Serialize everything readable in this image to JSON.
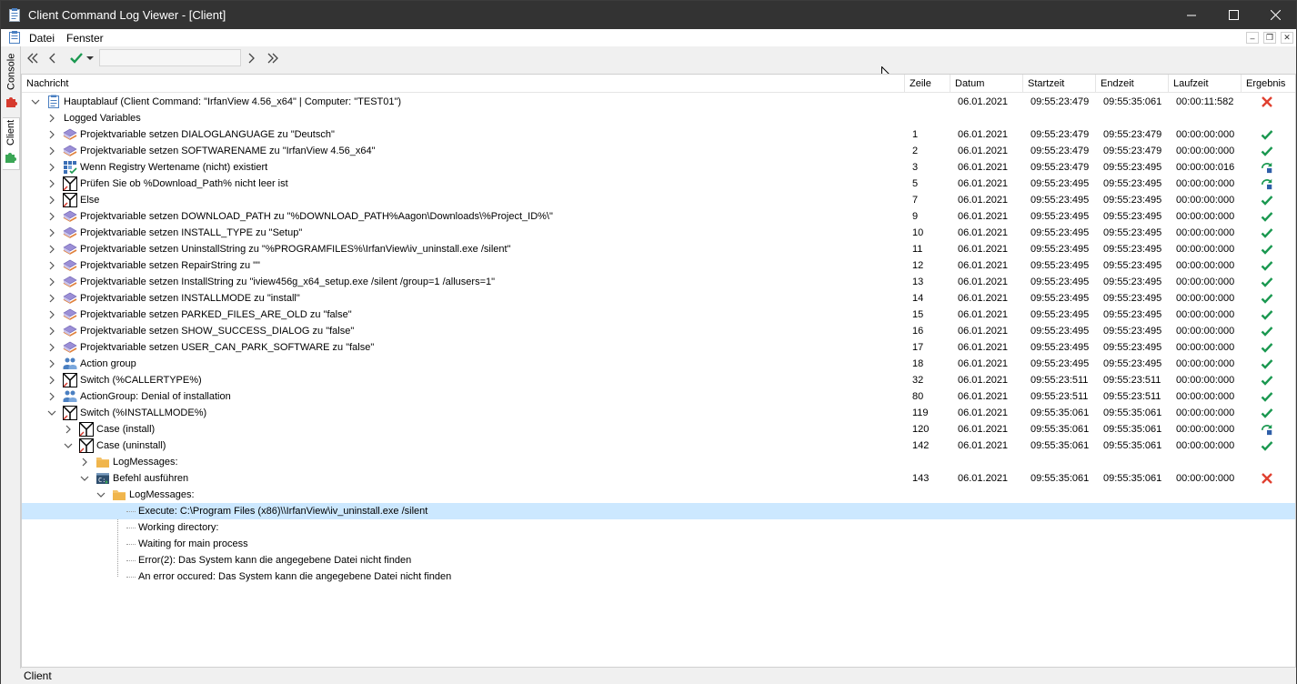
{
  "window": {
    "title": "Client Command Log Viewer - [Client]",
    "status": "Client",
    "colors": {
      "titlebar": "#333333",
      "selection": "#cce8ff",
      "ok": "#1a9850",
      "error": "#e04030"
    }
  },
  "menu": {
    "datei": "Datei",
    "fenster": "Fenster"
  },
  "side_tabs": {
    "console": "Console",
    "client": "Client"
  },
  "toolbar": {
    "first_icon": "double-chevron-left-icon",
    "prev_icon": "chevron-left-icon",
    "filter_icon": "check-filter-icon",
    "search_value": "",
    "next_icon": "chevron-right-icon",
    "last_icon": "double-chevron-right-icon"
  },
  "columns": {
    "nachricht": "Nachricht",
    "zeile": "Zeile",
    "datum": "Datum",
    "startzeit": "Startzeit",
    "endzeit": "Endzeit",
    "laufzeit": "Laufzeit",
    "ergebnis": "Ergebnis"
  },
  "rows": [
    {
      "level": 0,
      "expander": "open",
      "icon": "document",
      "text": "Hauptablauf (Client Command: \"IrfanView 4.56_x64\" | Computer: \"TEST01\")",
      "line": "",
      "date": "06.01.2021",
      "start": "09:55:23:479",
      "end": "09:55:35:061",
      "duration": "00:00:11:582",
      "result": "error"
    },
    {
      "level": 1,
      "expander": "closed",
      "icon": "none",
      "text": "Logged Variables",
      "line": "",
      "date": "",
      "start": "",
      "end": "",
      "duration": "",
      "result": ""
    },
    {
      "level": 1,
      "expander": "closed",
      "icon": "variable",
      "text": "Projektvariable setzen DIALOGLANGUAGE zu \"Deutsch\"",
      "line": "1",
      "date": "06.01.2021",
      "start": "09:55:23:479",
      "end": "09:55:23:479",
      "duration": "00:00:00:000",
      "result": "ok"
    },
    {
      "level": 1,
      "expander": "closed",
      "icon": "variable",
      "text": "Projektvariable setzen SOFTWARENAME zu \"IrfanView 4.56_x64\"",
      "line": "2",
      "date": "06.01.2021",
      "start": "09:55:23:479",
      "end": "09:55:23:479",
      "duration": "00:00:00:000",
      "result": "ok"
    },
    {
      "level": 1,
      "expander": "closed",
      "icon": "registry",
      "text": "Wenn Registry Wertename (nicht) existiert",
      "line": "3",
      "date": "06.01.2021",
      "start": "09:55:23:479",
      "end": "09:55:23:495",
      "duration": "00:00:00:016",
      "result": "skip"
    },
    {
      "level": 1,
      "expander": "closed",
      "icon": "switch",
      "text": "Prüfen Sie ob %Download_Path% nicht leer ist",
      "line": "5",
      "date": "06.01.2021",
      "start": "09:55:23:495",
      "end": "09:55:23:495",
      "duration": "00:00:00:000",
      "result": "skip"
    },
    {
      "level": 1,
      "expander": "closed",
      "icon": "switch",
      "text": "Else",
      "line": "7",
      "date": "06.01.2021",
      "start": "09:55:23:495",
      "end": "09:55:23:495",
      "duration": "00:00:00:000",
      "result": "ok"
    },
    {
      "level": 1,
      "expander": "closed",
      "icon": "variable",
      "text": "Projektvariable setzen DOWNLOAD_PATH zu \"%DOWNLOAD_PATH%Aagon\\Downloads\\%Project_ID%\\\"",
      "line": "9",
      "date": "06.01.2021",
      "start": "09:55:23:495",
      "end": "09:55:23:495",
      "duration": "00:00:00:000",
      "result": "ok"
    },
    {
      "level": 1,
      "expander": "closed",
      "icon": "variable",
      "text": "Projektvariable setzen INSTALL_TYPE zu \"Setup\"",
      "line": "10",
      "date": "06.01.2021",
      "start": "09:55:23:495",
      "end": "09:55:23:495",
      "duration": "00:00:00:000",
      "result": "ok"
    },
    {
      "level": 1,
      "expander": "closed",
      "icon": "variable",
      "text": "Projektvariable setzen UninstallString zu \"%PROGRAMFILES%\\IrfanView\\iv_uninstall.exe /silent\"",
      "line": "11",
      "date": "06.01.2021",
      "start": "09:55:23:495",
      "end": "09:55:23:495",
      "duration": "00:00:00:000",
      "result": "ok"
    },
    {
      "level": 1,
      "expander": "closed",
      "icon": "variable",
      "text": "Projektvariable setzen RepairString zu \"\"",
      "line": "12",
      "date": "06.01.2021",
      "start": "09:55:23:495",
      "end": "09:55:23:495",
      "duration": "00:00:00:000",
      "result": "ok"
    },
    {
      "level": 1,
      "expander": "closed",
      "icon": "variable",
      "text": "Projektvariable setzen InstallString zu \"iview456g_x64_setup.exe /silent /group=1 /allusers=1\"",
      "line": "13",
      "date": "06.01.2021",
      "start": "09:55:23:495",
      "end": "09:55:23:495",
      "duration": "00:00:00:000",
      "result": "ok"
    },
    {
      "level": 1,
      "expander": "closed",
      "icon": "variable",
      "text": "Projektvariable setzen INSTALLMODE zu \"install\"",
      "line": "14",
      "date": "06.01.2021",
      "start": "09:55:23:495",
      "end": "09:55:23:495",
      "duration": "00:00:00:000",
      "result": "ok"
    },
    {
      "level": 1,
      "expander": "closed",
      "icon": "variable",
      "text": "Projektvariable setzen PARKED_FILES_ARE_OLD zu \"false\"",
      "line": "15",
      "date": "06.01.2021",
      "start": "09:55:23:495",
      "end": "09:55:23:495",
      "duration": "00:00:00:000",
      "result": "ok"
    },
    {
      "level": 1,
      "expander": "closed",
      "icon": "variable",
      "text": "Projektvariable setzen SHOW_SUCCESS_DIALOG zu \"false\"",
      "line": "16",
      "date": "06.01.2021",
      "start": "09:55:23:495",
      "end": "09:55:23:495",
      "duration": "00:00:00:000",
      "result": "ok"
    },
    {
      "level": 1,
      "expander": "closed",
      "icon": "variable",
      "text": "Projektvariable setzen USER_CAN_PARK_SOFTWARE zu \"false\"",
      "line": "17",
      "date": "06.01.2021",
      "start": "09:55:23:495",
      "end": "09:55:23:495",
      "duration": "00:00:00:000",
      "result": "ok"
    },
    {
      "level": 1,
      "expander": "closed",
      "icon": "group",
      "text": "Action group",
      "line": "18",
      "date": "06.01.2021",
      "start": "09:55:23:495",
      "end": "09:55:23:495",
      "duration": "00:00:00:000",
      "result": "ok"
    },
    {
      "level": 1,
      "expander": "closed",
      "icon": "switch",
      "text": "Switch (%CALLERTYPE%)",
      "line": "32",
      "date": "06.01.2021",
      "start": "09:55:23:511",
      "end": "09:55:23:511",
      "duration": "00:00:00:000",
      "result": "ok"
    },
    {
      "level": 1,
      "expander": "closed",
      "icon": "group",
      "text": "ActionGroup: Denial of installation",
      "line": "80",
      "date": "06.01.2021",
      "start": "09:55:23:511",
      "end": "09:55:23:511",
      "duration": "00:00:00:000",
      "result": "ok"
    },
    {
      "level": 1,
      "expander": "open",
      "icon": "switch",
      "text": "Switch (%INSTALLMODE%)",
      "line": "119",
      "date": "06.01.2021",
      "start": "09:55:35:061",
      "end": "09:55:35:061",
      "duration": "00:00:00:000",
      "result": "ok"
    },
    {
      "level": 2,
      "expander": "closed",
      "icon": "switch",
      "text": "Case (install)",
      "line": "120",
      "date": "06.01.2021",
      "start": "09:55:35:061",
      "end": "09:55:35:061",
      "duration": "00:00:00:000",
      "result": "skip"
    },
    {
      "level": 2,
      "expander": "open",
      "icon": "switch",
      "text": "Case (uninstall)",
      "line": "142",
      "date": "06.01.2021",
      "start": "09:55:35:061",
      "end": "09:55:35:061",
      "duration": "00:00:00:000",
      "result": "ok"
    },
    {
      "level": 3,
      "expander": "closed",
      "icon": "folder",
      "text": "LogMessages:",
      "line": "",
      "date": "",
      "start": "",
      "end": "",
      "duration": "",
      "result": ""
    },
    {
      "level": 3,
      "expander": "open",
      "icon": "command",
      "text": "Befehl ausführen",
      "line": "143",
      "date": "06.01.2021",
      "start": "09:55:35:061",
      "end": "09:55:35:061",
      "duration": "00:00:00:000",
      "result": "error"
    },
    {
      "level": 4,
      "expander": "open",
      "icon": "folder",
      "text": "LogMessages:",
      "line": "",
      "date": "",
      "start": "",
      "end": "",
      "duration": "",
      "result": ""
    },
    {
      "level": 5,
      "expander": "none",
      "icon": "none",
      "selected": true,
      "text": "Execute: C:\\Program Files (x86)\\\\IrfanView\\iv_uninstall.exe /silent",
      "line": "",
      "date": "",
      "start": "",
      "end": "",
      "duration": "",
      "result": ""
    },
    {
      "level": 5,
      "expander": "none",
      "icon": "none",
      "text": "Working directory:",
      "line": "",
      "date": "",
      "start": "",
      "end": "",
      "duration": "",
      "result": ""
    },
    {
      "level": 5,
      "expander": "none",
      "icon": "none",
      "text": "Waiting for main process",
      "line": "",
      "date": "",
      "start": "",
      "end": "",
      "duration": "",
      "result": ""
    },
    {
      "level": 5,
      "expander": "none",
      "icon": "none",
      "text": "Error(2): Das System kann die angegebene Datei nicht finden",
      "line": "",
      "date": "",
      "start": "",
      "end": "",
      "duration": "",
      "result": ""
    },
    {
      "level": 5,
      "expander": "none",
      "icon": "none",
      "text": "An error occured: Das System kann die angegebene Datei nicht finden",
      "line": "",
      "date": "",
      "start": "",
      "end": "",
      "duration": "",
      "result": ""
    }
  ]
}
